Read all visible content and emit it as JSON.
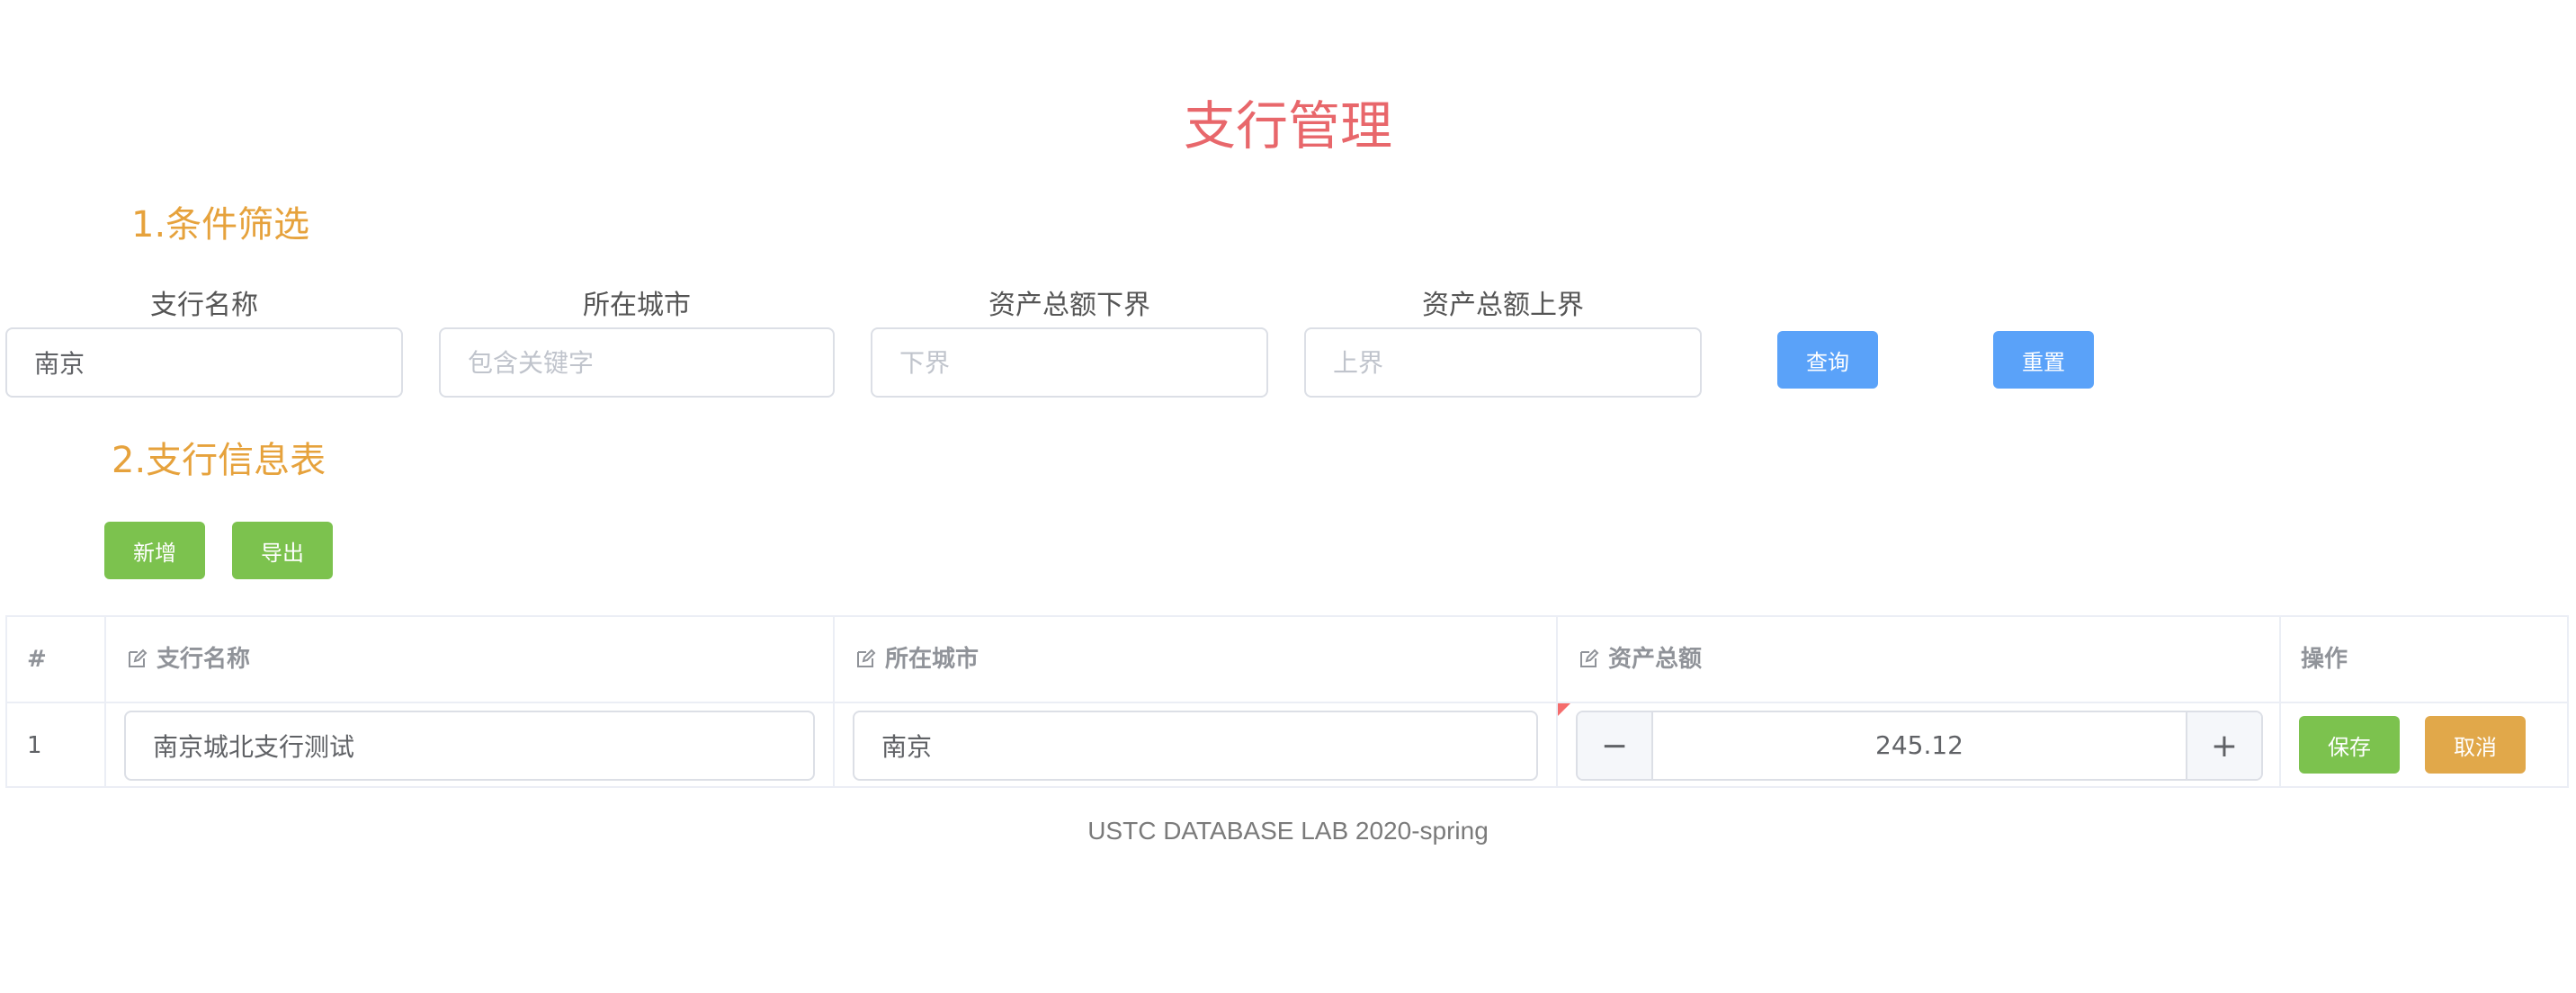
{
  "page": {
    "title": "支行管理",
    "footer": "USTC DATABASE LAB 2020-spring"
  },
  "filter": {
    "section_title": "1.条件筛选",
    "fields": [
      {
        "label": "支行名称",
        "value": "南京",
        "placeholder": ""
      },
      {
        "label": "所在城市",
        "value": "",
        "placeholder": "包含关键字"
      },
      {
        "label": "资产总额下界",
        "value": "",
        "placeholder": "下界"
      },
      {
        "label": "资产总额上界",
        "value": "",
        "placeholder": "上界"
      }
    ],
    "query_button": "查询",
    "reset_button": "重置"
  },
  "table_section": {
    "section_title": "2.支行信息表",
    "add_button": "新增",
    "export_button": "导出",
    "headers": [
      "#",
      "支行名称",
      "所在城市",
      "资产总额",
      "操作"
    ],
    "rows": [
      {
        "index": "1",
        "name": "南京城北支行测试",
        "city": "南京",
        "assets": "245.12",
        "save_label": "保存",
        "cancel_label": "取消"
      }
    ]
  },
  "icons": {
    "header_edit": "edit-icon",
    "minus": "minus-icon",
    "plus": "plus-icon"
  },
  "colors": {
    "title": "#e8676b",
    "section": "#e6a23c",
    "primary": "#5aa2f9",
    "success": "#7cc24e",
    "warning": "#e1a84a"
  }
}
